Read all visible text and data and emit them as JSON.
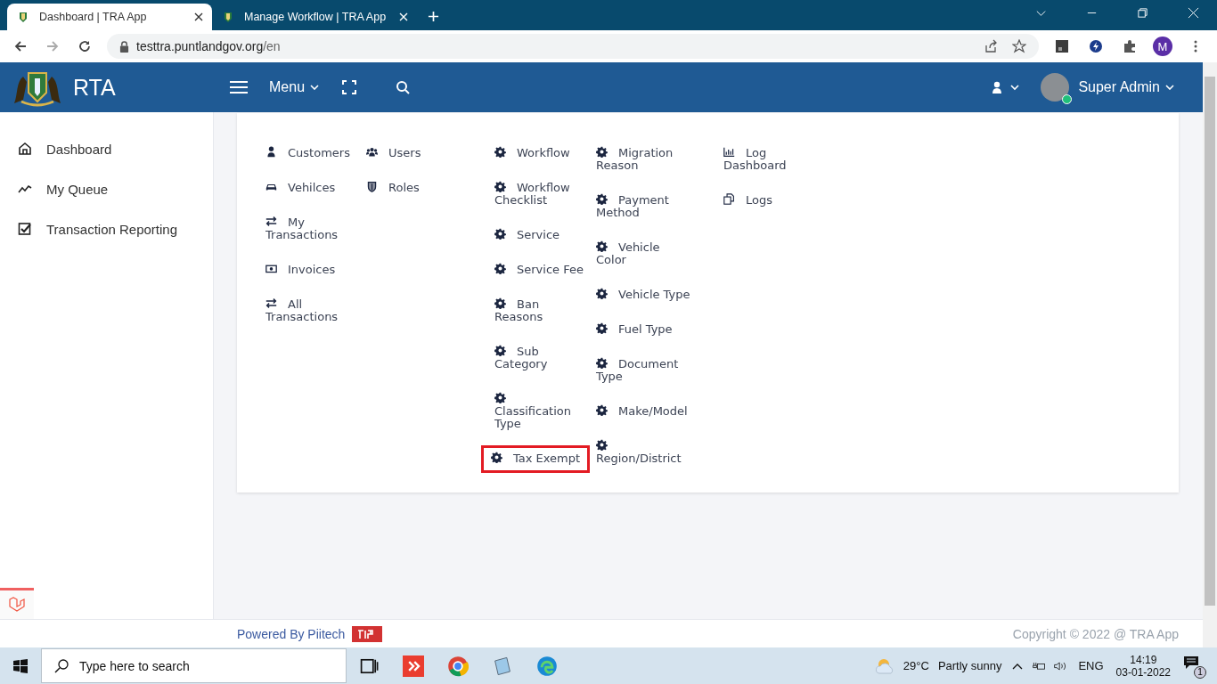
{
  "browser": {
    "tabs": [
      {
        "title": "Dashboard | TRA App",
        "selected": true
      },
      {
        "title": "Manage Workflow | TRA App",
        "selected": false
      }
    ],
    "url_host": "testtra.puntlandgov.org",
    "url_path": "/en",
    "profile_initial": "M"
  },
  "header": {
    "logo_text": "RTA",
    "menu_label": "Menu",
    "user_name": "Super Admin",
    "online": true
  },
  "sidebar": {
    "items": [
      {
        "label": "Dashboard",
        "kind": "home"
      },
      {
        "label": "My Queue",
        "kind": "trend"
      },
      {
        "label": "Transaction Reporting",
        "kind": "check"
      }
    ]
  },
  "mega_menu": {
    "columns": [
      [
        {
          "label": "Customers",
          "kind": "user",
          "highlighted": false
        },
        {
          "label": "Vehilces",
          "kind": "car",
          "highlighted": false
        },
        {
          "label": "My Transactions",
          "kind": "exchange",
          "highlighted": false
        },
        {
          "label": "Invoices",
          "kind": "money",
          "highlighted": false
        },
        {
          "label": "All Transactions",
          "kind": "exchange",
          "highlighted": false
        }
      ],
      [
        {
          "label": "Users",
          "kind": "users",
          "highlighted": false
        },
        {
          "label": "Roles",
          "kind": "shield",
          "highlighted": false
        }
      ],
      [
        {
          "label": "Workflow",
          "kind": "cog",
          "highlighted": false
        },
        {
          "label": "Workflow Checklist",
          "kind": "cog",
          "highlighted": false
        },
        {
          "label": "Service",
          "kind": "cog",
          "highlighted": false
        },
        {
          "label": "Service Fee",
          "kind": "cog",
          "highlighted": false
        },
        {
          "label": "Ban Reasons",
          "kind": "cog",
          "highlighted": false
        },
        {
          "label": "Sub Category",
          "kind": "cog",
          "highlighted": false
        },
        {
          "label": "Classification Type",
          "kind": "cog",
          "highlighted": false
        },
        {
          "label": "Tax Exempt",
          "kind": "cog",
          "highlighted": true
        }
      ],
      [
        {
          "label": "Migration Reason",
          "kind": "cog",
          "highlighted": false
        },
        {
          "label": "Payment Method",
          "kind": "cog",
          "highlighted": false
        },
        {
          "label": "Vehicle Color",
          "kind": "cog",
          "highlighted": false
        },
        {
          "label": "Vehicle Type",
          "kind": "cog",
          "highlighted": false
        },
        {
          "label": "Fuel Type",
          "kind": "cog",
          "highlighted": false
        },
        {
          "label": "Document Type",
          "kind": "cog",
          "highlighted": false
        },
        {
          "label": "Make/Model",
          "kind": "cog",
          "highlighted": false
        },
        {
          "label": "Region/District",
          "kind": "cog",
          "highlighted": false
        }
      ],
      [
        {
          "label": "Log Dashboard",
          "kind": "chart",
          "highlighted": false
        },
        {
          "label": "Logs",
          "kind": "copy",
          "highlighted": false
        }
      ]
    ]
  },
  "footer": {
    "powered_by": "Powered By Piitech",
    "copyright": "Copyright © 2022 @ TRA App"
  },
  "taskbar": {
    "search_placeholder": "Type here to search",
    "temperature": "29°C",
    "weather": "Partly sunny",
    "language": "ENG",
    "time": "14:19",
    "date": "03-01-2022",
    "notifications": "1"
  }
}
